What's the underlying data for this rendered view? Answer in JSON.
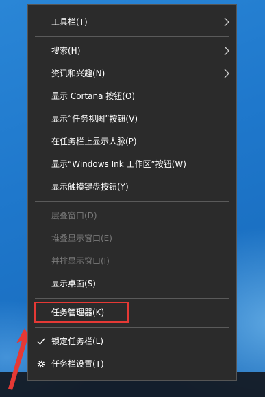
{
  "menu": {
    "items": [
      {
        "label": "工具栏(T)",
        "submenu": true
      },
      {
        "label": "搜索(H)",
        "submenu": true
      },
      {
        "label": "资讯和兴趣(N)",
        "submenu": true
      },
      {
        "label": "显示 Cortana 按钮(O)"
      },
      {
        "label": "显示“任务视图”按钮(V)"
      },
      {
        "label": "在任务栏上显示人脉(P)"
      },
      {
        "label": "显示“Windows Ink 工作区”按钮(W)"
      },
      {
        "label": "显示触摸键盘按钮(Y)"
      },
      {
        "label": "层叠窗口(D)",
        "disabled": true
      },
      {
        "label": "堆叠显示窗口(E)",
        "disabled": true
      },
      {
        "label": "并排显示窗口(I)",
        "disabled": true
      },
      {
        "label": "显示桌面(S)"
      },
      {
        "label": "任务管理器(K)",
        "highlighted": true
      },
      {
        "label": "锁定任务栏(L)",
        "checked": true,
        "icon": "checkmark-icon"
      },
      {
        "label": "任务栏设置(T)",
        "icon": "gear-icon"
      }
    ]
  },
  "colors": {
    "menu_background": "#2b2b2b",
    "highlight_border": "#e53935",
    "desktop_blue": "#1e7fd0"
  }
}
